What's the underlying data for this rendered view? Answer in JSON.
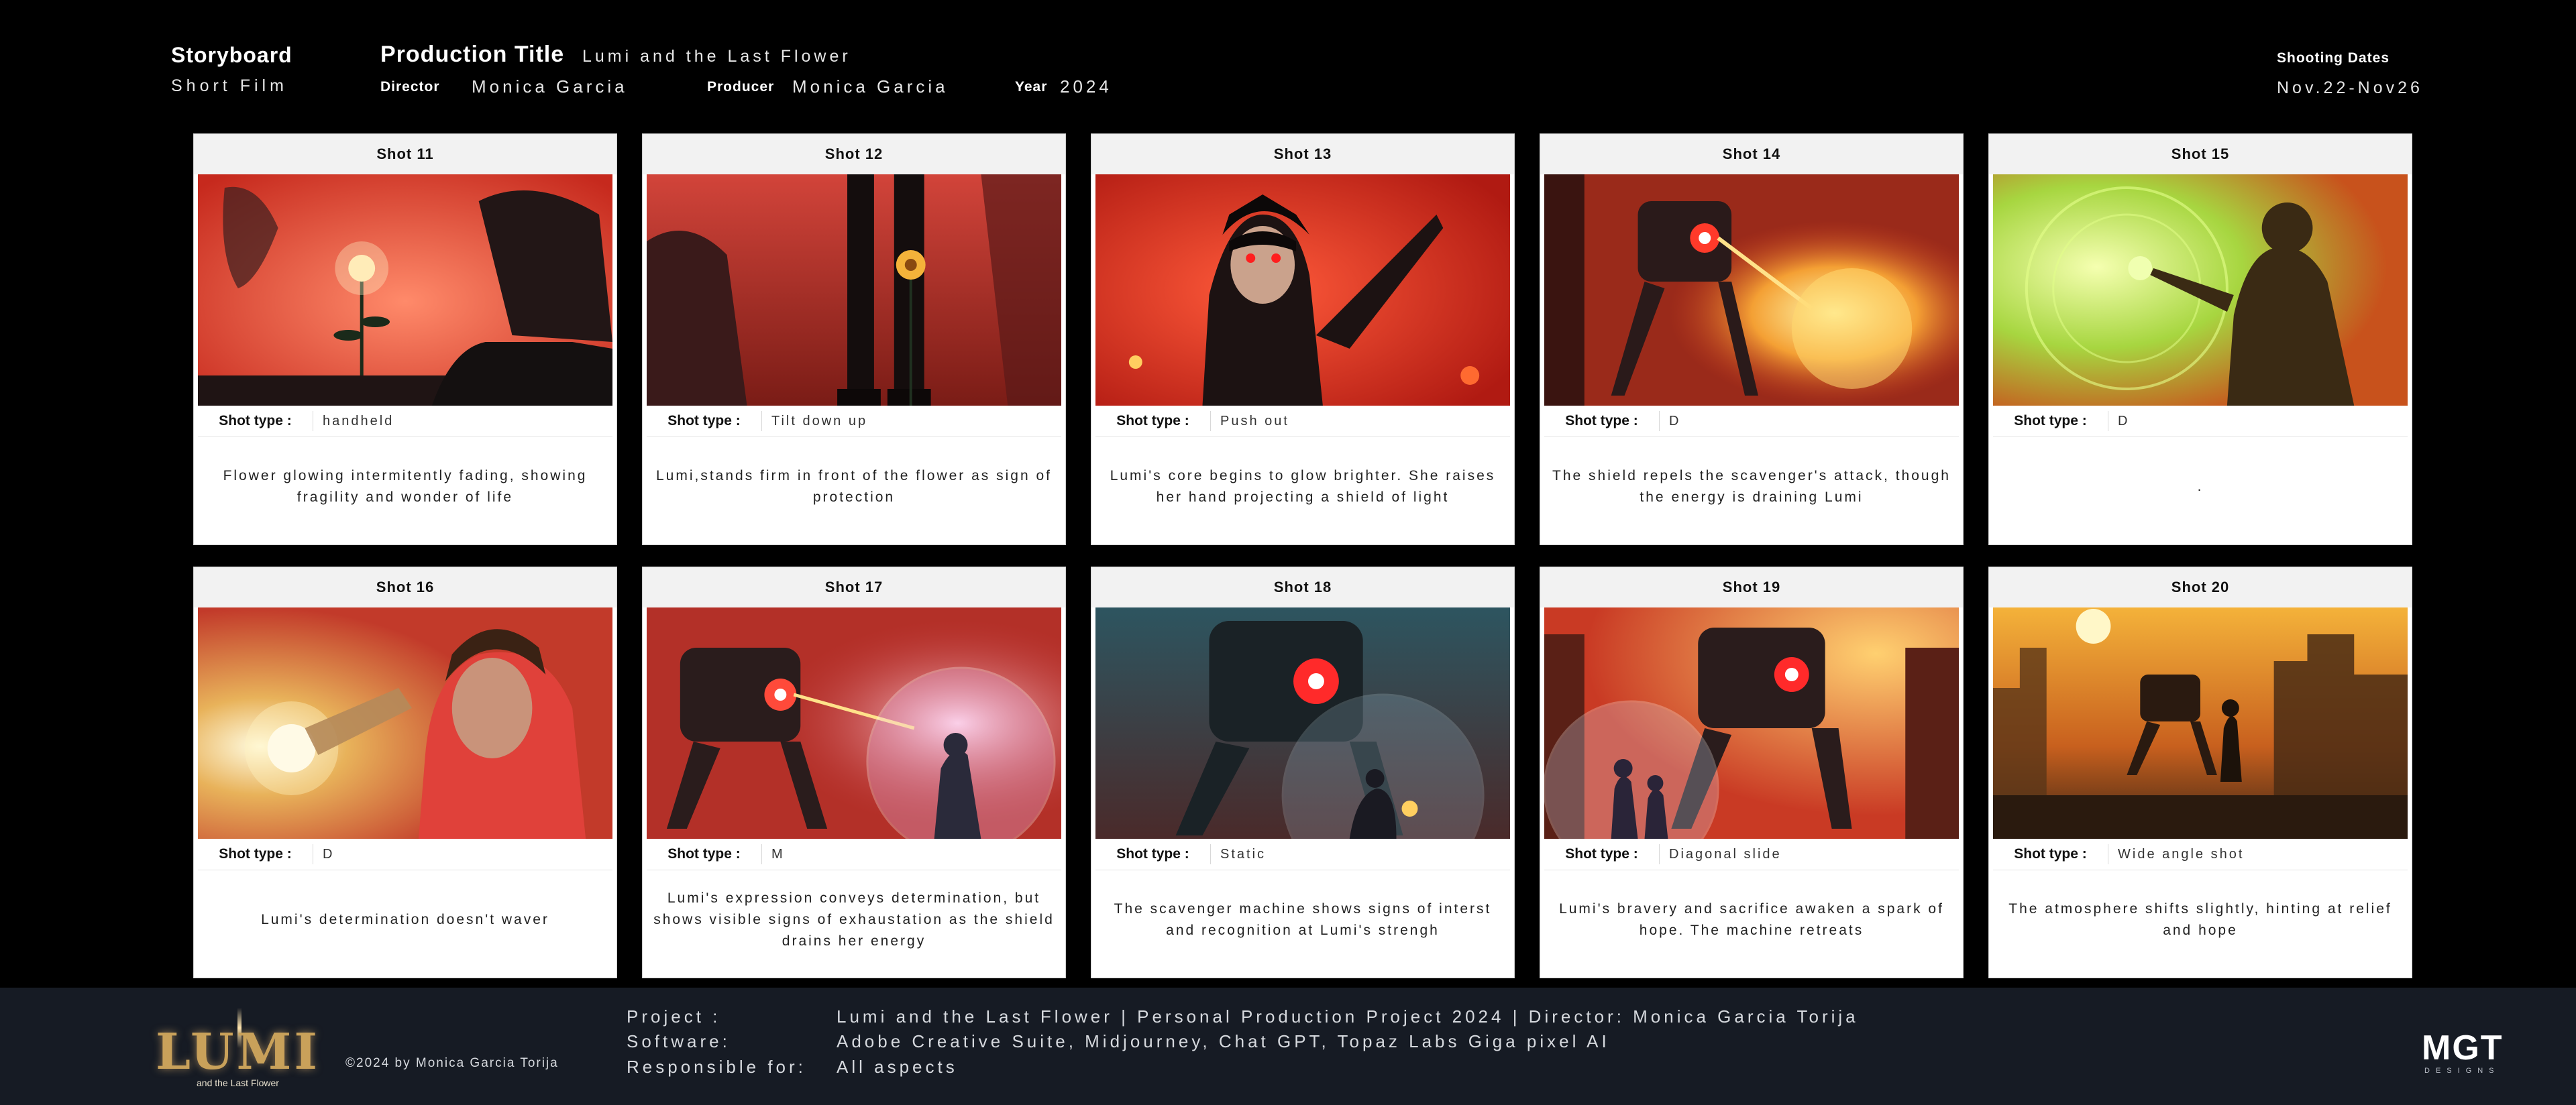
{
  "header": {
    "brand": "Storyboard",
    "category": "Short Film",
    "production_title_label": "Production Title",
    "production_title": "Lumi and the Last Flower",
    "director_label": "Director",
    "director": "Monica Garcia",
    "producer_label": "Producer",
    "producer": "Monica Garcia",
    "year_label": "Year",
    "year": "2024",
    "shooting_dates_label": "Shooting Dates",
    "shooting_dates": "Nov.22-Nov26"
  },
  "shot_type_label": "Shot type :",
  "shots": [
    {
      "title": "Shot 11",
      "type": "handheld",
      "desc": "Flower glowing intermitently fading, showing fragility and wonder of life",
      "scene": "flower"
    },
    {
      "title": "Shot 12",
      "type": "Tilt down up",
      "desc": "Lumi,stands firm in front of the flower as sign of protection",
      "scene": "legs"
    },
    {
      "title": "Shot 13",
      "type": "Push out",
      "desc": "Lumi's core begins to glow brighter. She raises her hand projecting a shield of light",
      "scene": "face"
    },
    {
      "title": "Shot 14",
      "type": "D",
      "desc": "The shield repels the scavenger's attack, though the energy is draining Lumi",
      "scene": "robot_blast"
    },
    {
      "title": "Shot 15",
      "type": "D",
      "desc": ".",
      "scene": "green_shield"
    },
    {
      "title": "Shot 16",
      "type": "D",
      "desc": "Lumi's determination doesn't waver",
      "scene": "closeup_glow"
    },
    {
      "title": "Shot 17",
      "type": "M",
      "desc": "Lumi's expression conveys determination, but shows visible signs of exhaustation as the shield drains her energy",
      "scene": "robot_bubble"
    },
    {
      "title": "Shot 18",
      "type": "Static",
      "desc": "The scavenger machine shows signs of interst and recognition at Lumi's strengh",
      "scene": "robot_blue"
    },
    {
      "title": "Shot 19",
      "type": "Diagonal slide",
      "desc": "Lumi's bravery and sacrifice awaken a spark of hope. The machine retreats",
      "scene": "robot_kids"
    },
    {
      "title": "Shot 20",
      "type": "Wide angle shot",
      "desc": "The atmosphere shifts slightly, hinting at relief and hope",
      "scene": "sunset"
    }
  ],
  "footer": {
    "project_label": "Project :",
    "project": "Lumi and the Last Flower | Personal Production Project 2024 | Director: Monica Garcia Torija",
    "software_label": "Software:",
    "software": "Adobe Creative Suite, Midjourney, Chat GPT, Topaz Labs Giga pixel AI",
    "responsible_label": "Responsible for:",
    "responsible": "All aspects",
    "copyright": "©2024  by Monica Garcia Torija",
    "logo_text": "LUMI",
    "logo_sub": "and the Last Flower",
    "studio_logo": "MGT",
    "studio_sub": "DESIGNS"
  },
  "colors": {
    "background": "#000000",
    "card": "#ffffff",
    "footer": "#161b24",
    "scene_red": "#e8432f",
    "scene_orange": "#f28a2e",
    "scene_green": "#b7e04a",
    "scene_teal": "#2d5560"
  }
}
